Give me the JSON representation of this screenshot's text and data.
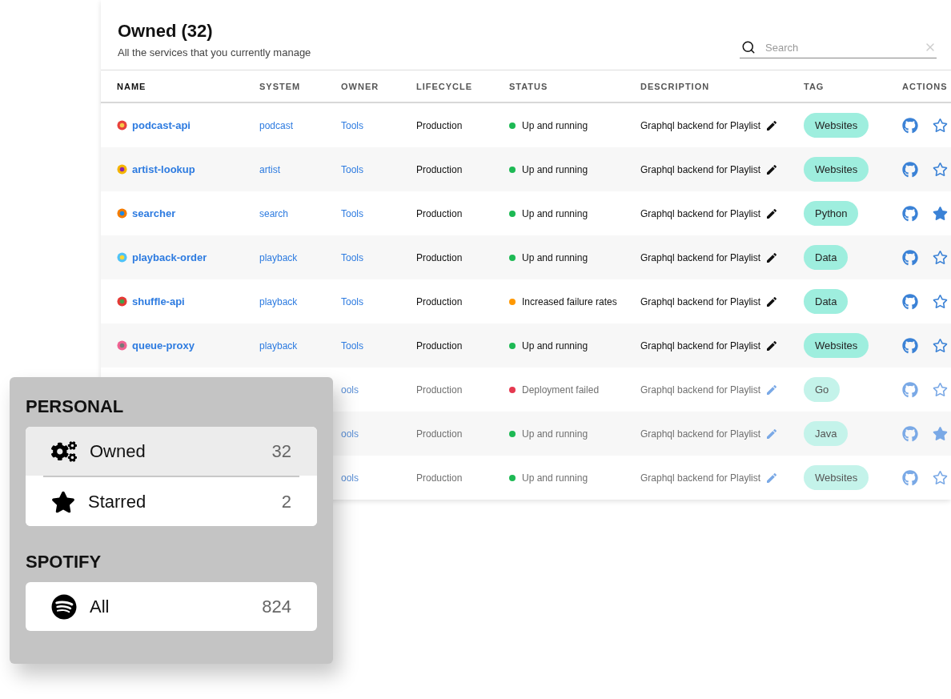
{
  "header": {
    "title": "Owned (32)",
    "subtitle": "All the services that you currently manage",
    "search": {
      "placeholder": "Search"
    }
  },
  "table": {
    "columns": [
      "NAME",
      "SYSTEM",
      "OWNER",
      "LIFECYCLE",
      "STATUS",
      "DESCRIPTION",
      "TAG",
      "ACTIONS"
    ],
    "rows": [
      {
        "name": "podcast-api",
        "system": "podcast",
        "owner": "Tools",
        "lifecycle": "Production",
        "status": {
          "text": "Up and running",
          "color": "#1db954"
        },
        "description": "Graphql backend for Playlist",
        "tag": "Websites",
        "starred": false,
        "dimmed": false
      },
      {
        "name": "artist-lookup",
        "system": "artist",
        "owner": "Tools",
        "lifecycle": "Production",
        "status": {
          "text": "Up and running",
          "color": "#1db954"
        },
        "description": "Graphql backend for Playlist",
        "tag": "Websites",
        "starred": false,
        "dimmed": false
      },
      {
        "name": "searcher",
        "system": "search",
        "owner": "Tools",
        "lifecycle": "Production",
        "status": {
          "text": "Up and running",
          "color": "#1db954"
        },
        "description": "Graphql backend for Playlist",
        "tag": "Python",
        "starred": true,
        "dimmed": false
      },
      {
        "name": "playback-order",
        "system": "playback",
        "owner": "Tools",
        "lifecycle": "Production",
        "status": {
          "text": "Up and running",
          "color": "#1db954"
        },
        "description": "Graphql backend for Playlist",
        "tag": "Data",
        "starred": false,
        "dimmed": false
      },
      {
        "name": "shuffle-api",
        "system": "playback",
        "owner": "Tools",
        "lifecycle": "Production",
        "status": {
          "text": "Increased failure rates",
          "color": "#ff9800"
        },
        "description": "Graphql backend for Playlist",
        "tag": "Data",
        "starred": false,
        "dimmed": false
      },
      {
        "name": "queue-proxy",
        "system": "playback",
        "owner": "Tools",
        "lifecycle": "Production",
        "status": {
          "text": "Up and running",
          "color": "#1db954"
        },
        "description": "Graphql backend for Playlist",
        "tag": "Websites",
        "starred": false,
        "dimmed": false
      },
      {
        "owner": "ools",
        "lifecycle": "Production",
        "status": {
          "text": "Deployment failed",
          "color": "#e53950"
        },
        "description": "Graphql backend for Playlist",
        "tag": "Go",
        "starred": false,
        "dimmed": true
      },
      {
        "owner": "ools",
        "lifecycle": "Production",
        "status": {
          "text": "Up and running",
          "color": "#1db954"
        },
        "description": "Graphql backend for Playlist",
        "tag": "Java",
        "starred": true,
        "dimmed": true
      },
      {
        "owner": "ools",
        "lifecycle": "Production",
        "status": {
          "text": "Up and running",
          "color": "#1db954"
        },
        "description": "Graphql backend for Playlist",
        "tag": "Websites",
        "starred": false,
        "dimmed": true
      }
    ]
  },
  "sidebar": {
    "sections": [
      {
        "title": "PERSONAL",
        "items": [
          {
            "kind": "owned",
            "label": "Owned",
            "count": "32",
            "selected": true
          },
          {
            "kind": "starred",
            "label": "Starred",
            "count": "2",
            "selected": false
          }
        ]
      },
      {
        "title": "SPOTIFY",
        "items": [
          {
            "kind": "all",
            "label": "All",
            "count": "824",
            "selected": false
          }
        ]
      }
    ]
  }
}
